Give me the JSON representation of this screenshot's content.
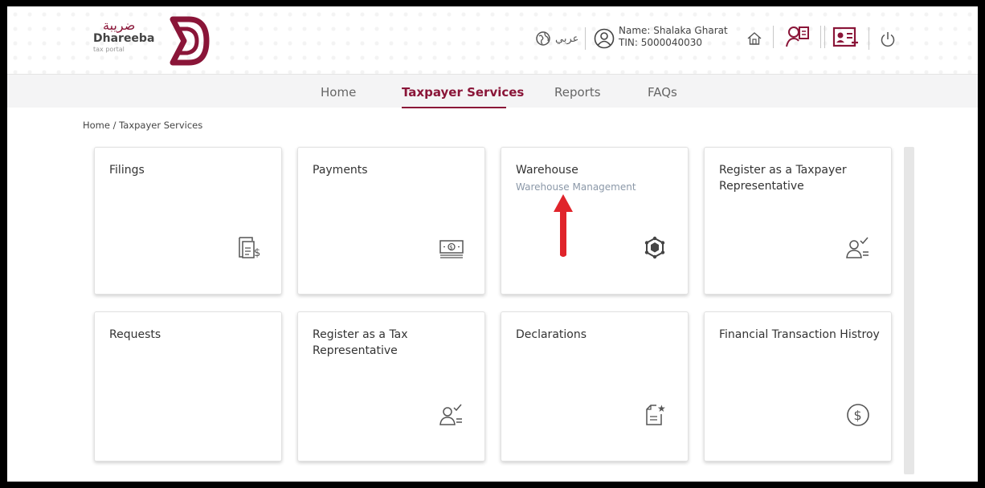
{
  "header": {
    "logo_ar": "ضريبة",
    "logo_name": "Dhareeba",
    "logo_sub": "tax portal",
    "language": "عربي",
    "user_name": "Name: Shalaka Gharat",
    "user_tin": "TIN: 5000040030"
  },
  "nav": {
    "items": [
      {
        "label": "Home"
      },
      {
        "label": "Taxpayer Services"
      },
      {
        "label": "Reports"
      },
      {
        "label": "FAQs"
      }
    ],
    "active": "Taxpayer Services"
  },
  "breadcrumb": "Home / Taxpayer Services",
  "cards": [
    {
      "title": "Filings",
      "subtitle": "",
      "icon": "filing-dollar-icon"
    },
    {
      "title": "Payments",
      "subtitle": "",
      "icon": "cash-icon"
    },
    {
      "title": "Warehouse",
      "subtitle": "Warehouse Management",
      "icon": "cube-network-icon"
    },
    {
      "title": "Register as a Taxpayer Representative",
      "subtitle": "",
      "icon": "user-check-icon"
    },
    {
      "title": "Requests",
      "subtitle": "",
      "icon": ""
    },
    {
      "title": "Register as a Tax Representative",
      "subtitle": "",
      "icon": "user-check-icon"
    },
    {
      "title": "Declarations",
      "subtitle": "",
      "icon": "document-star-icon"
    },
    {
      "title": "Financial Transaction Histroy",
      "subtitle": "",
      "icon": "dollar-circle-icon"
    }
  ],
  "colors": {
    "brand": "#8a1538",
    "annotation_arrow": "#e0242b"
  }
}
